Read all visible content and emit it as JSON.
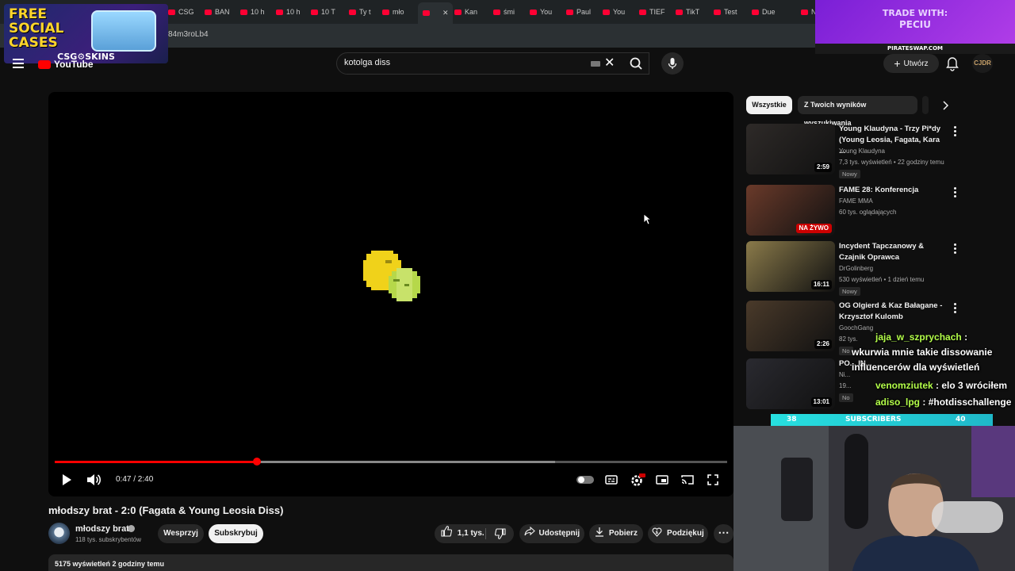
{
  "browser": {
    "tabs": [
      "CSG",
      "BAN",
      "10 h",
      "10 h",
      "10 T",
      "Ty t",
      "mło",
      "",
      "Kan",
      "śmi",
      "You",
      "Paul",
      "You",
      "TIEF",
      "TikT",
      "Test",
      "Due",
      "Naj"
    ],
    "url": "84m3roLb4"
  },
  "overlays": {
    "promo": {
      "line1": "FREE",
      "line2": "SOCIAL",
      "line3": "CASES",
      "brand": "CSG⚙SKINS"
    },
    "trade": {
      "line1": "TRADE WITH:",
      "line2": "PECIU",
      "site": "PIRATESWAP.COM"
    }
  },
  "header": {
    "logo_text": "YouTube",
    "search_value": "kotolga diss",
    "create_label": "Utwórz",
    "avatar_text": "CJDR",
    "icons": [
      "menu-icon",
      "keyboard-icon",
      "close-icon",
      "search-icon",
      "mic-icon",
      "plus-icon",
      "bell-icon"
    ]
  },
  "player": {
    "time": "0:47 / 2:40",
    "progress": 0.301,
    "buffered": 0.744,
    "controls": [
      "play-icon",
      "volume-icon",
      "autoplay-toggle",
      "subtitles-icon",
      "settings-icon",
      "miniplayer-icon",
      "cast-icon",
      "fullscreen-icon"
    ]
  },
  "video": {
    "title": "młodszy brat - 2:0 (Fagata & Young Leosia Diss)",
    "channel": "młodszy brat",
    "subscribers": "118 tys. subskrybentów",
    "support_label": "Wesprzyj",
    "subscribe_label": "Subskrybuj",
    "likes": "1,1 tys.",
    "share_label": "Udostępnij",
    "download_label": "Pobierz",
    "thanks_label": "Podziękuj",
    "description_meta": "5175 wyświetleń  2 godziny temu"
  },
  "sidebar": {
    "chips": [
      "Wszystkie",
      "Z Twoich wyników wyszukiwania"
    ],
    "recommendations": [
      {
        "title": "Young Klaudyna - Trzy Pi*dy (Young Leosia, Fagata, Kara ...",
        "channel": "Young Klaudyna",
        "meta": "7,3 tys. wyświetleń • 22 godziny temu",
        "badge": "Nowy",
        "duration": "2:59",
        "thumb_color": "#2e2a28"
      },
      {
        "title": "FAME 28: Konferencja",
        "channel": "FAME MMA",
        "meta": "60 tys. oglądających",
        "badge": "",
        "duration": "NA ŻYWO",
        "thumb_color": "#6a3a2a"
      },
      {
        "title": "Incydent Tapczanowy & Czajnik Oprawca",
        "channel": "DrGolinberg",
        "meta": "530 wyświetleń • 1 dzień temu",
        "badge": "Nowy",
        "duration": "16:11",
        "thumb_color": "#8a7a4a"
      },
      {
        "title": "OG Olgierd & Kaz Bałagane - Krzysztof Kulomb",
        "channel": "GoochGang",
        "meta": "82 tys.",
        "badge": "No",
        "duration": "2:26",
        "thumb_color": "#4a3a2a"
      },
      {
        "title": "PO... IN...",
        "channel": "Ni...",
        "meta": "19...",
        "badge": "No",
        "duration": "13:01",
        "thumb_color": "#2a2a30"
      }
    ]
  },
  "chat": [
    {
      "user": "jaja_w_szprychach",
      "message": ":"
    },
    {
      "user": "",
      "message": "wkurwia mnie takie dissowanie"
    },
    {
      "user": "",
      "message": "influencerów dla wyświetleń"
    },
    {
      "user": "venomziutek",
      "message": ": elo 3 wróciłem"
    },
    {
      "user": "adiso_lpg",
      "message": ": #hotdisschallenge"
    }
  ],
  "stream": {
    "sub_current": "38",
    "sub_label": "SUBSCRIBERS",
    "sub_goal": "40"
  }
}
